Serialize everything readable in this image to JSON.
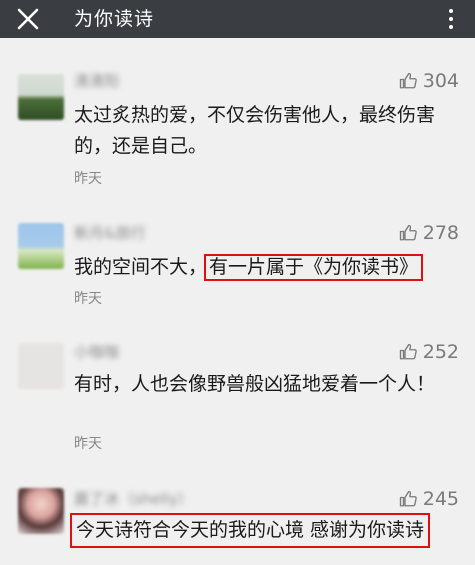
{
  "header": {
    "title": "为你读诗"
  },
  "comments": [
    {
      "name": "清清阳",
      "likes": "304",
      "text": "太过炙热的爱，不仅会伤害他人，最终伤害的，还是自己。",
      "time": "昨天"
    },
    {
      "name": "新月&旅行",
      "likes": "278",
      "text_prefix": "我的空间不大，",
      "text_highlight": "有一片属于《为你读书》",
      "time": "昨天"
    },
    {
      "name": "小咖咖",
      "likes": "252",
      "text": "有时，人也会像野兽般凶猛地爱着一个人！",
      "time": "昨天"
    },
    {
      "name": "晨了冰（shelly）",
      "likes": "245",
      "text_highlight": "今天诗符合今天的我的心境 感谢为你读诗"
    }
  ]
}
